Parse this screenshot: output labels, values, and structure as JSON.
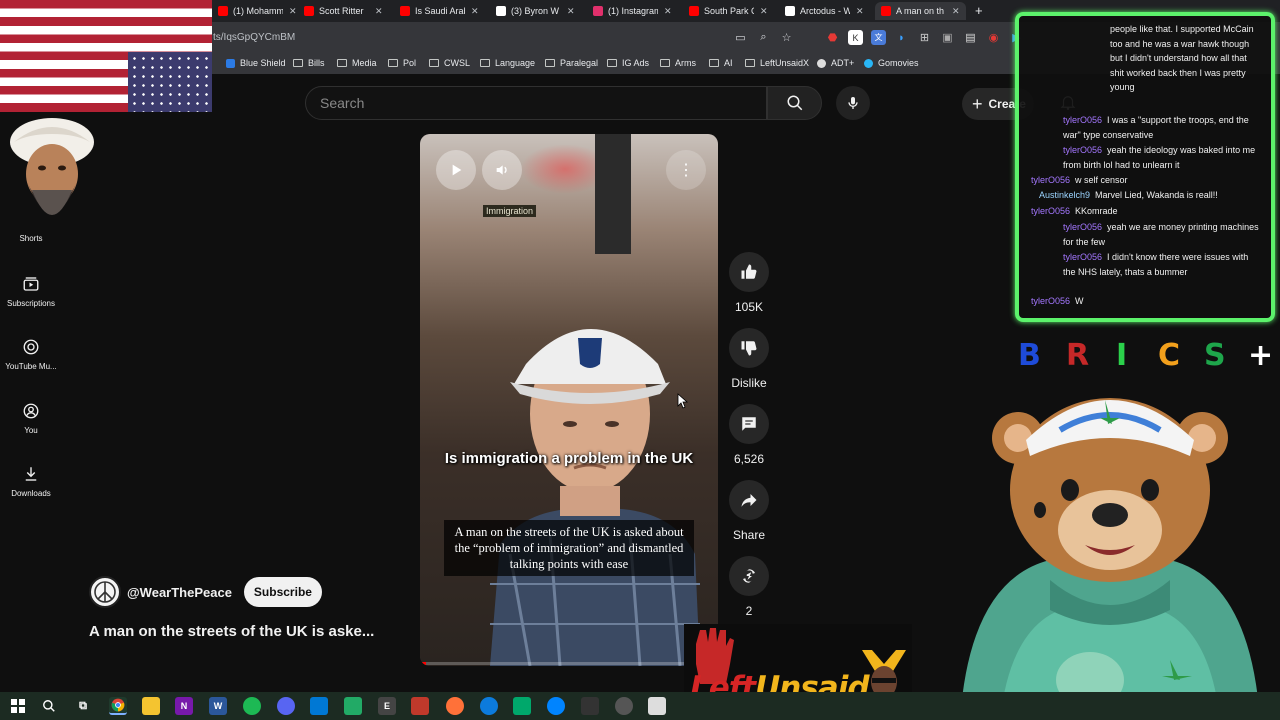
{
  "browser": {
    "tabs": [
      {
        "label": "(1) Mohamm",
        "favicon_color": "#ff0000"
      },
      {
        "label": "Scott Ritter",
        "favicon_color": "#ff0000"
      },
      {
        "label": "Is Saudi Arab",
        "favicon_color": "#ff0000"
      },
      {
        "label": "(3) Byron W",
        "favicon_color": "#ffffff"
      },
      {
        "label": "(1) Instagram",
        "favicon_color": "#e1306c"
      },
      {
        "label": "South Park C",
        "favicon_color": "#ff0000"
      },
      {
        "label": "Arctodus - W",
        "favicon_color": "#ffffff"
      },
      {
        "label": "A man on th",
        "favicon_color": "#ff0000",
        "active": true
      }
    ],
    "new_tab_label": "+",
    "url": "ts/IqsGpQYCmBM",
    "bookmarks": [
      {
        "label": "Blue Shield",
        "kind": "site"
      },
      {
        "label": "Bills",
        "kind": "folder"
      },
      {
        "label": "Media",
        "kind": "folder"
      },
      {
        "label": "Pol",
        "kind": "folder"
      },
      {
        "label": "CWSL",
        "kind": "folder"
      },
      {
        "label": "Language",
        "kind": "folder"
      },
      {
        "label": "Paralegal",
        "kind": "folder"
      },
      {
        "label": "IG Ads",
        "kind": "folder"
      },
      {
        "label": "Arms",
        "kind": "folder"
      },
      {
        "label": "AI",
        "kind": "folder"
      },
      {
        "label": "LeftUnsaidX",
        "kind": "folder"
      },
      {
        "label": "ADT+",
        "kind": "site"
      },
      {
        "label": "Gomovies",
        "kind": "site"
      }
    ]
  },
  "youtube": {
    "search_placeholder": "Search",
    "create_label": "Create",
    "sidebar": [
      {
        "label": "Shorts",
        "icon": "shorts-icon"
      },
      {
        "label": "Subscriptions",
        "icon": "subscriptions-icon"
      },
      {
        "label": "YouTube Mu...",
        "icon": "youtube-music-icon"
      },
      {
        "label": "You",
        "icon": "user-icon"
      },
      {
        "label": "Downloads",
        "icon": "download-icon"
      }
    ],
    "video": {
      "overlay_tag": "Immigration",
      "caption_main": "Is immigration a problem in the UK",
      "caption_sub": "A man on the streets of the UK is asked about the “problem of immigration” and dismantled talking points with ease",
      "progress": 0.02
    },
    "actions": {
      "like_count": "105K",
      "dislike_label": "Dislike",
      "comment_count": "6,526",
      "share_label": "Share",
      "remix_count": "2"
    },
    "channel": {
      "handle": "@WearThePeace",
      "subscribe_label": "Subscribe"
    },
    "title": "A man on the streets of the UK is aske..."
  },
  "chat": {
    "messages": [
      {
        "user": "",
        "text": "people like that. I supported McCain too and he was a war hawk though but I didn't understand how all that shit worked back then I was pretty young",
        "user_color": "#a477ff"
      },
      {
        "user": "tylerO056",
        "text": "I was a \"support the troops, end the war\" type conservative",
        "user_color": "#a477ff"
      },
      {
        "user": "tylerO056",
        "text": "yeah the ideology was baked into me from birth lol had to unlearn it",
        "user_color": "#a477ff"
      },
      {
        "user": "tylerO056",
        "text": "w self censor",
        "user_color": "#a477ff"
      },
      {
        "user": "Austinkelch9",
        "text": "Marvel Lied, Wakanda is reall!!",
        "user_color": "#9bd4ff"
      },
      {
        "user": "tylerO056",
        "text": "KKomrade",
        "user_color": "#a477ff"
      },
      {
        "user": "tylerO056",
        "text": "yeah we are money printing machines for the few",
        "user_color": "#a477ff"
      },
      {
        "user": "tylerO056",
        "text": "I didn't know there were issues with the NHS lately, thats a bummer",
        "user_color": "#a477ff"
      },
      {
        "user": "tylerO056",
        "text": "W",
        "user_color": "#a477ff"
      }
    ],
    "border_color": "#5cf26b"
  },
  "letters": [
    {
      "char": "B",
      "color": "#1e4bd8"
    },
    {
      "char": "R",
      "color": "#1e4bd8"
    },
    {
      "char": "I",
      "color": "#2bd14b"
    },
    {
      "char": "C",
      "color": "#f2a01c"
    },
    {
      "char": "S",
      "color": "#1ea64b"
    },
    {
      "char": "+",
      "color": "#ffffff"
    }
  ],
  "logo": {
    "part1": "Left",
    "part2": "Unsaid"
  }
}
